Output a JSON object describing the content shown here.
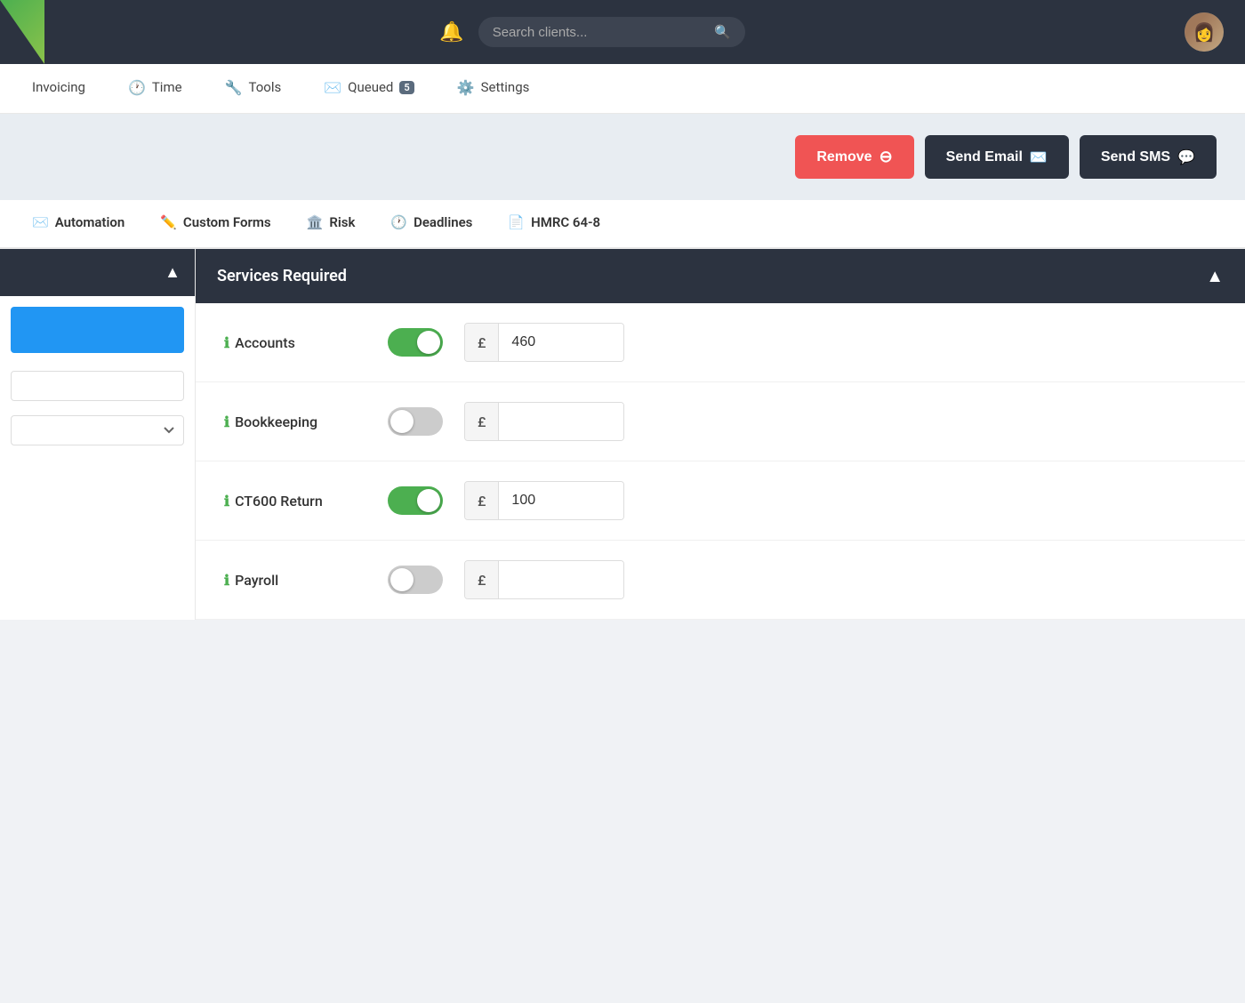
{
  "topbar": {
    "search_placeholder": "Search clients...",
    "bell_label": "notifications"
  },
  "nav": {
    "items": [
      {
        "id": "invoicing",
        "label": "Invoicing",
        "icon": "📄"
      },
      {
        "id": "time",
        "label": "Time",
        "icon": "🕐"
      },
      {
        "id": "tools",
        "label": "Tools",
        "icon": "🔧"
      },
      {
        "id": "queued",
        "label": "Queued",
        "icon": "✉️",
        "badge": "5"
      },
      {
        "id": "settings",
        "label": "Settings",
        "icon": "⚙️"
      }
    ]
  },
  "actions": {
    "remove_label": "Remove",
    "send_email_label": "Send Email",
    "send_sms_label": "Send SMS"
  },
  "tabs": [
    {
      "id": "automation",
      "label": "Automation",
      "icon": "✉️"
    },
    {
      "id": "custom-forms",
      "label": "Custom Forms",
      "icon": "✏️"
    },
    {
      "id": "risk",
      "label": "Risk",
      "icon": "🏛️"
    },
    {
      "id": "deadlines",
      "label": "Deadlines",
      "icon": "🕐"
    },
    {
      "id": "hmrc",
      "label": "HMRC 64-8",
      "icon": "📄"
    }
  ],
  "services": {
    "panel_title": "Services Required",
    "items": [
      {
        "id": "accounts",
        "label": "Accounts",
        "enabled": true,
        "amount": "460"
      },
      {
        "id": "bookkeeping",
        "label": "Bookkeeping",
        "enabled": false,
        "amount": ""
      },
      {
        "id": "ct600",
        "label": "CT600 Return",
        "enabled": true,
        "amount": "100"
      },
      {
        "id": "payroll",
        "label": "Payroll",
        "enabled": false,
        "amount": ""
      }
    ],
    "currency_symbol": "£"
  }
}
